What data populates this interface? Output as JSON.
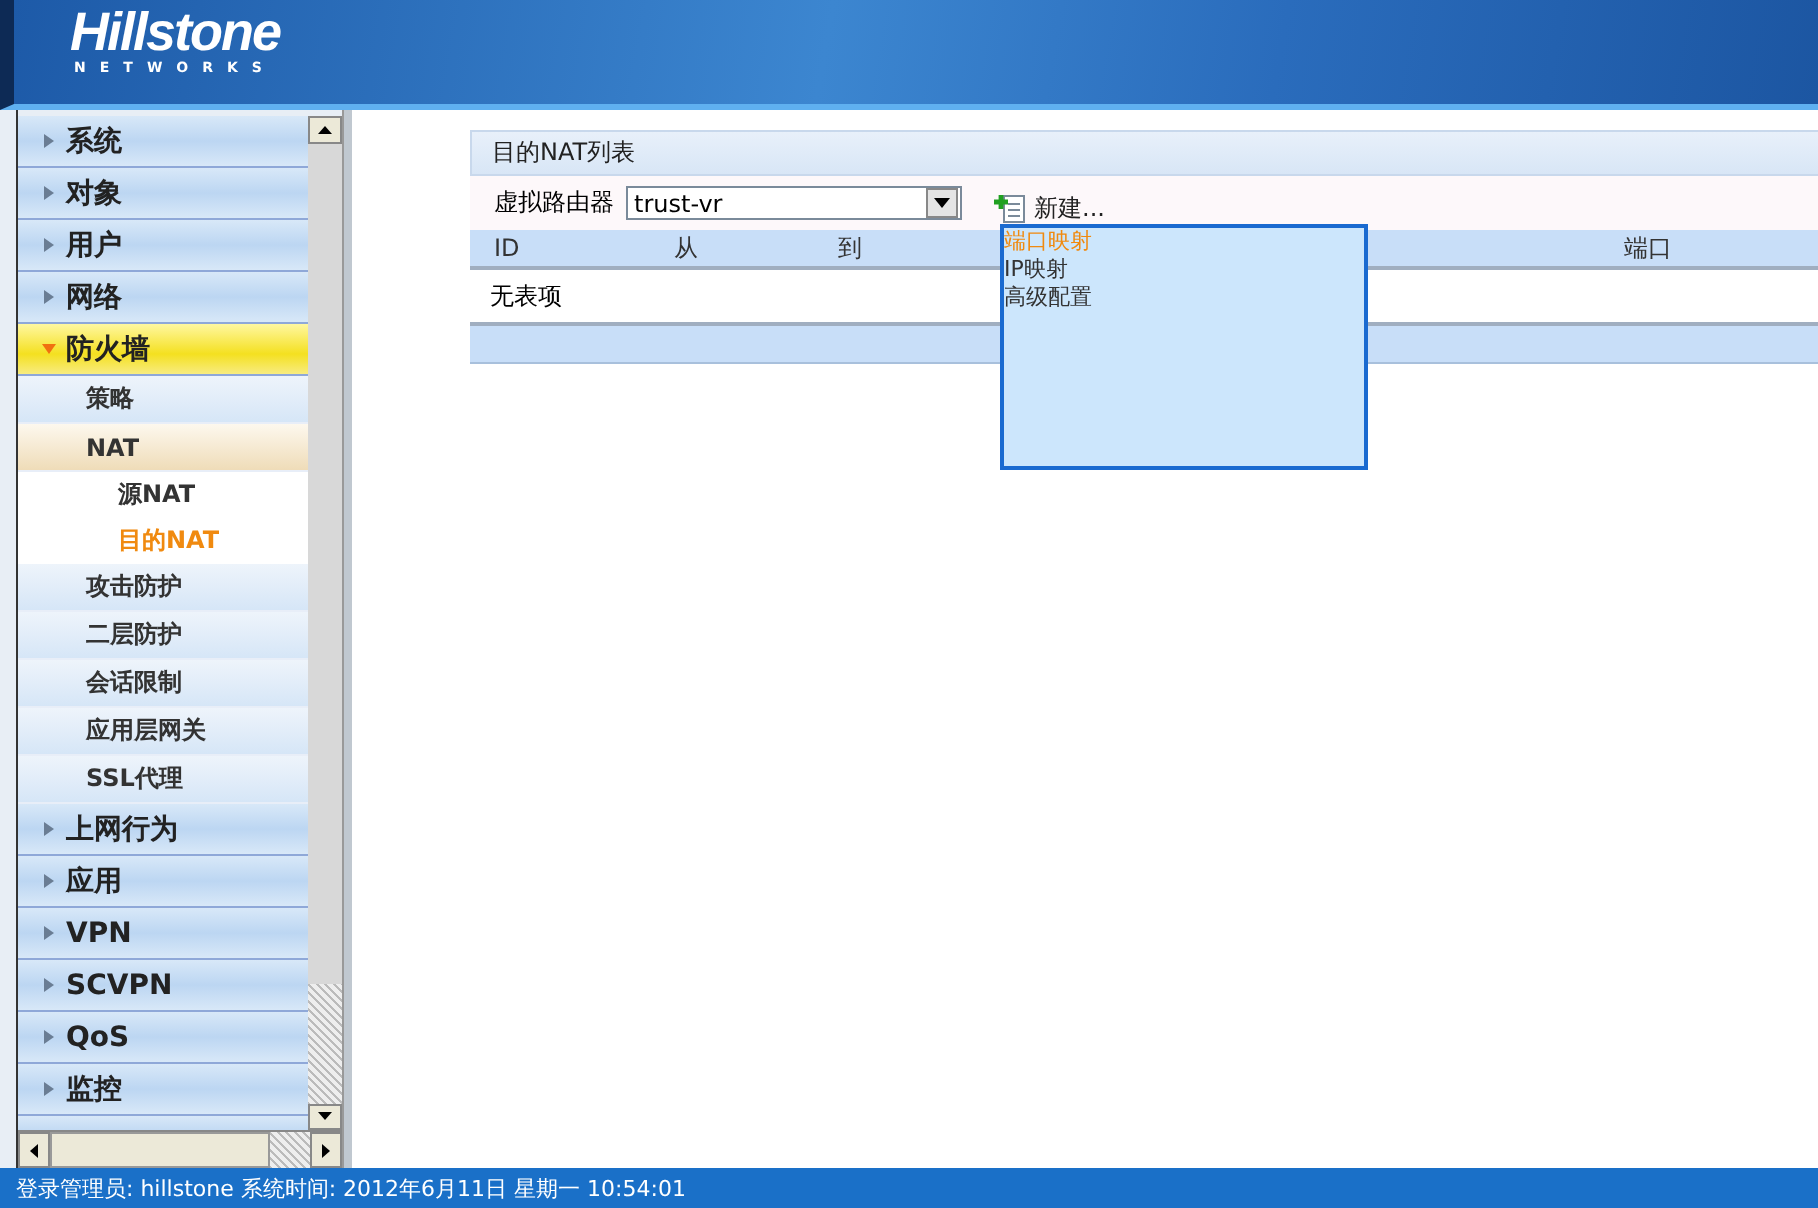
{
  "header": {
    "logo_text": "Hillstone",
    "logo_subtext": "NETWORKS"
  },
  "sidebar": {
    "items": [
      {
        "label": "系统",
        "expanded": false
      },
      {
        "label": "对象",
        "expanded": false
      },
      {
        "label": "用户",
        "expanded": false
      },
      {
        "label": "网络",
        "expanded": false
      },
      {
        "label": "防火墙",
        "expanded": true,
        "children": [
          {
            "label": "策略",
            "expanded": false,
            "selected": false
          },
          {
            "label": "NAT",
            "expanded": true,
            "selected": false,
            "children": [
              {
                "label": "源NAT",
                "selected": false
              },
              {
                "label": "目的NAT",
                "selected": true
              }
            ]
          },
          {
            "label": "攻击防护",
            "expanded": false,
            "selected": false
          },
          {
            "label": "二层防护",
            "expanded": false,
            "selected": false
          },
          {
            "label": "会话限制",
            "expanded": false,
            "selected": false
          },
          {
            "label": "应用层网关",
            "expanded": false,
            "selected": false
          },
          {
            "label": "SSL代理",
            "expanded": false,
            "selected": false
          }
        ]
      },
      {
        "label": "上网行为",
        "expanded": false
      },
      {
        "label": "应用",
        "expanded": false
      },
      {
        "label": "VPN",
        "expanded": false
      },
      {
        "label": "SCVPN",
        "expanded": false
      },
      {
        "label": "QoS",
        "expanded": false
      },
      {
        "label": "监控",
        "expanded": false
      }
    ]
  },
  "panel": {
    "title": "目的NAT列表",
    "vr_label": "虚拟路由器",
    "vr_value": "trust-vr",
    "new_button": "新建...",
    "table": {
      "columns": [
        "ID",
        "从",
        "到",
        "",
        "端口"
      ],
      "empty_text": "无表项"
    },
    "new_menu": [
      {
        "label": "端口映射",
        "selected": true
      },
      {
        "label": "IP映射",
        "selected": false
      },
      {
        "label": "高级配置",
        "selected": false
      }
    ]
  },
  "status_bar": {
    "text": "登录管理员: hillstone 系统时间: 2012年6月11日 星期一 10:54:01"
  }
}
